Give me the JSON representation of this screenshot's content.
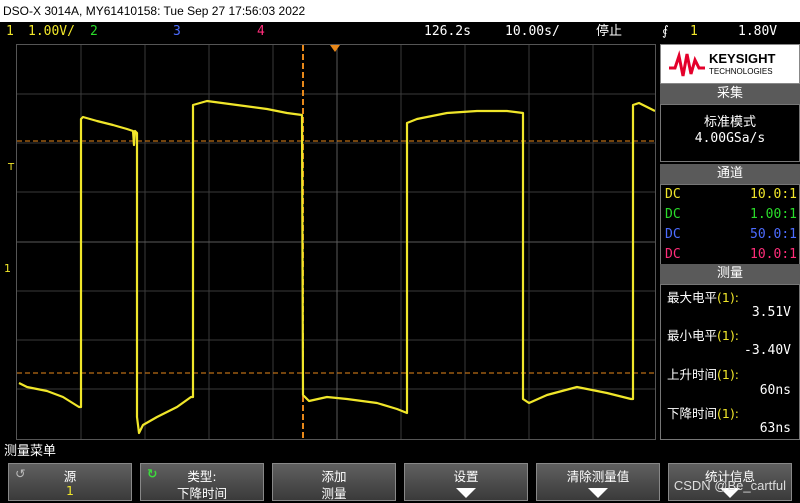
{
  "window": {
    "title": "DSO-X 3014A, MY61410158: Tue Sep 27 17:56:03 2022"
  },
  "status": {
    "ch1_num": "1",
    "ch1_scale": "1.00V/",
    "ch2_num": "2",
    "ch3_num": "3",
    "ch4_num": "4",
    "time_pos": "126.2s",
    "time_scale": "10.00s/",
    "run_state": "停止",
    "trig_icon": "↑ trigger-edge",
    "trig_src": "1",
    "trig_level": "1.80V"
  },
  "colors": {
    "ch1": "#f0e62a",
    "ch2": "#2adc2a",
    "ch3": "#4c6cff",
    "ch4": "#ff2d7a",
    "cursor": "#e8881a"
  },
  "logo": {
    "brand": "KEYSIGHT",
    "sub": "TECHNOLOGIES"
  },
  "acq": {
    "title": "采集",
    "mode": "标准模式",
    "rate": "4.00GSa/s"
  },
  "channels": {
    "title": "通道",
    "rows": [
      {
        "cpl": "DC",
        "probe": "10.0:1",
        "color": "#f0e62a"
      },
      {
        "cpl": "DC",
        "probe": "1.00:1",
        "color": "#2adc2a"
      },
      {
        "cpl": "DC",
        "probe": "50.0:1",
        "color": "#4c6cff"
      },
      {
        "cpl": "DC",
        "probe": "10.0:1",
        "color": "#ff2d7a"
      }
    ]
  },
  "measure": {
    "title": "测量",
    "items": [
      {
        "label": "最大电平",
        "src": "(1):",
        "value": "3.51V"
      },
      {
        "label": "最小电平",
        "src": "(1):",
        "value": "-3.40V"
      },
      {
        "label": "上升时间",
        "src": "(1):",
        "value": "60ns"
      },
      {
        "label": "下降时间",
        "src": "(1):",
        "value": "63ns"
      }
    ]
  },
  "grid_labels": {
    "trig_marker": "T",
    "ch1_marker": "1"
  },
  "softkeys": {
    "menu_title": "测量菜单",
    "k1_top": "源",
    "k1_bot": "1",
    "k2_top": "类型:",
    "k2_bot": "下降时间",
    "k3_top": "添加",
    "k3_bot": "测量",
    "k4_top": "设置",
    "k5_top": "清除测量值",
    "k6_top": "统计信息"
  },
  "watermark": "CSDN @Be_cartful"
}
